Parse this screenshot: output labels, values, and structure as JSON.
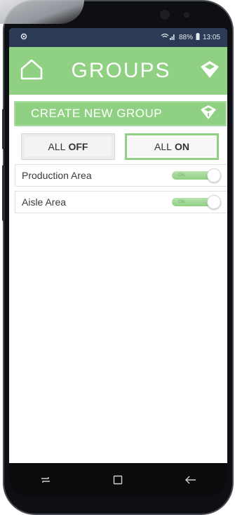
{
  "status_bar": {
    "left_icon": "sync-icon",
    "signal": "wifi-signal-icon",
    "battery": "88%",
    "time": "13:05"
  },
  "header": {
    "title": "GROUPS",
    "home_icon": "home-icon",
    "cube_icon": "box-icon"
  },
  "create_group": {
    "label": "CREATE NEW GROUP",
    "icon": "box-icon"
  },
  "all_controls": {
    "off": {
      "prefix": "ALL",
      "emphasis": "OFF"
    },
    "on": {
      "prefix": "ALL",
      "emphasis": "ON"
    }
  },
  "groups": [
    {
      "name": "Production Area",
      "state": "ON"
    },
    {
      "name": "Aisle Area",
      "state": "ON"
    }
  ],
  "colors": {
    "accent": "#8fd083",
    "status_bar": "#2b3a55",
    "nav_bar": "#0b0b0d"
  },
  "nav_bar": {
    "recent": "recent-apps-icon",
    "home": "home-square-icon",
    "back": "back-arrow-icon"
  }
}
